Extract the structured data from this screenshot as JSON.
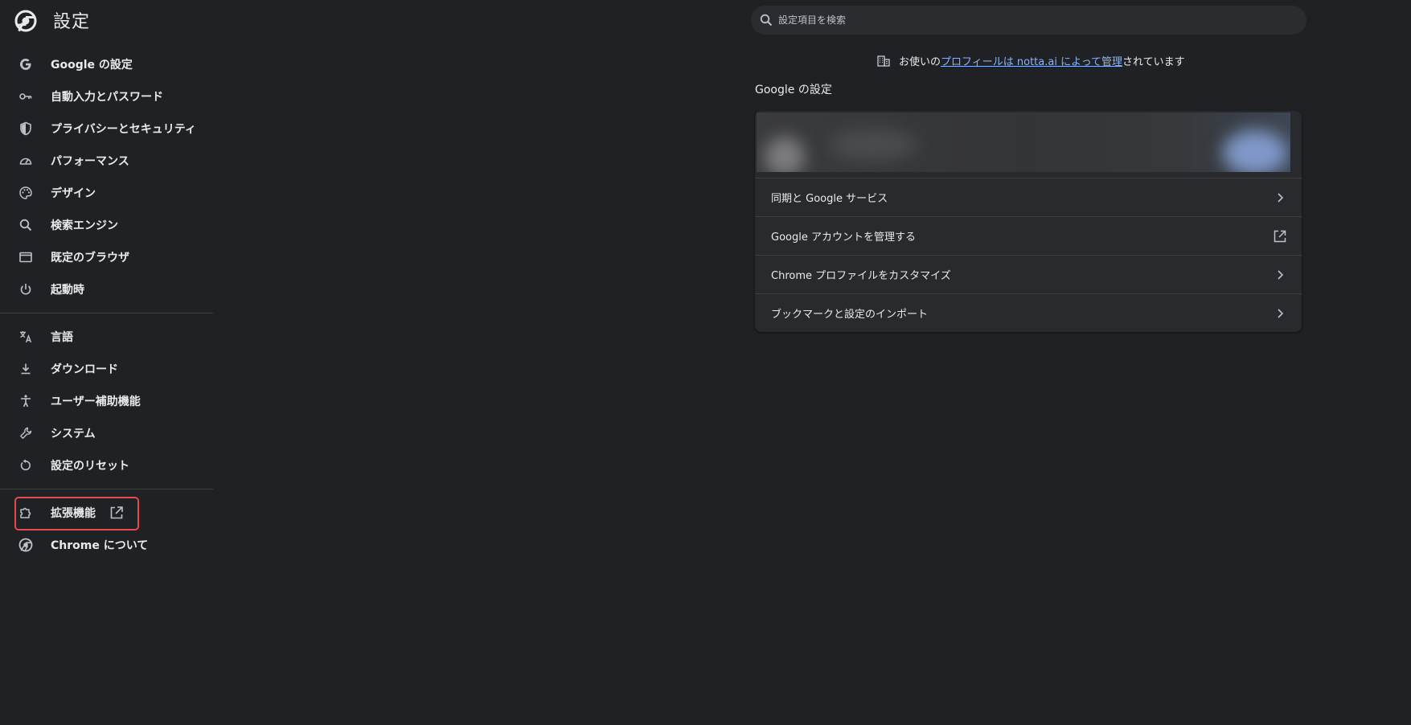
{
  "header": {
    "title": "設定"
  },
  "sidebar": {
    "items": [
      {
        "label": "Google の設定"
      },
      {
        "label": "自動入力とパスワード"
      },
      {
        "label": "プライバシーとセキュリティ"
      },
      {
        "label": "パフォーマンス"
      },
      {
        "label": "デザイン"
      },
      {
        "label": "検索エンジン"
      },
      {
        "label": "既定のブラウザ"
      },
      {
        "label": "起動時"
      },
      {
        "label": "言語"
      },
      {
        "label": "ダウンロード"
      },
      {
        "label": "ユーザー補助機能"
      },
      {
        "label": "システム"
      },
      {
        "label": "設定のリセット"
      },
      {
        "label": "拡張機能"
      },
      {
        "label": "Chrome について"
      }
    ]
  },
  "search": {
    "placeholder": "設定項目を検索"
  },
  "managed_notice": {
    "prefix": "お使いの",
    "link": "プロフィールは notta.ai によって管理",
    "suffix": "されています"
  },
  "main": {
    "section_title": "Google の設定",
    "rows": [
      {
        "label": "同期と Google サービス"
      },
      {
        "label": "Google アカウントを管理する"
      },
      {
        "label": "Chrome プロファイルをカスタマイズ"
      },
      {
        "label": "ブックマークと設定のインポート"
      }
    ]
  },
  "colors": {
    "background": "#202124",
    "text": "#e8eaed",
    "link": "#8ab4f8",
    "highlight": "#e5484d",
    "card": "#292a2d"
  }
}
